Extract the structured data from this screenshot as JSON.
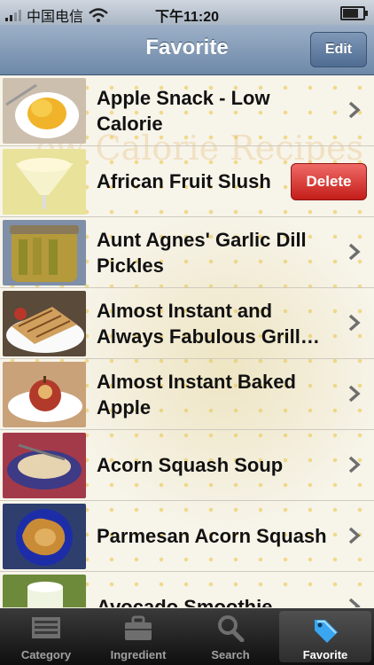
{
  "status_bar": {
    "carrier": "中国电信",
    "time": "下午11:20",
    "signal_bars": 2,
    "battery_level": 0.85
  },
  "navbar": {
    "title": "Favorite",
    "edit_label": "Edit"
  },
  "list": {
    "watermark": "ow Calorie Recipes",
    "items": [
      {
        "title": "Apple Snack - Low Calorie",
        "thumb": "apple-snack",
        "action": "chevron"
      },
      {
        "title": "African Fruit Slush",
        "thumb": "fruit-slush",
        "action": "delete",
        "delete_label": "Delete"
      },
      {
        "title": "Aunt Agnes' Garlic Dill Pickles",
        "thumb": "pickles",
        "action": "chevron"
      },
      {
        "title": "Almost Instant and Always Fabulous Grill…",
        "thumb": "grilled-sandwich",
        "action": "chevron"
      },
      {
        "title": "Almost Instant Baked Apple",
        "thumb": "baked-apple",
        "action": "chevron"
      },
      {
        "title": "Acorn Squash Soup",
        "thumb": "squash-soup",
        "action": "chevron"
      },
      {
        "title": "Parmesan Acorn Squash",
        "thumb": "acorn-squash",
        "action": "chevron"
      },
      {
        "title": "Avocado Smoothie",
        "thumb": "smoothie",
        "action": "chevron"
      }
    ]
  },
  "tabbar": {
    "tabs": [
      {
        "label": "Category",
        "icon": "category-icon",
        "active": false
      },
      {
        "label": "Ingredient",
        "icon": "briefcase-icon",
        "active": false
      },
      {
        "label": "Search",
        "icon": "search-icon",
        "active": false
      },
      {
        "label": "Favorite",
        "icon": "tag-icon",
        "active": true
      }
    ]
  }
}
